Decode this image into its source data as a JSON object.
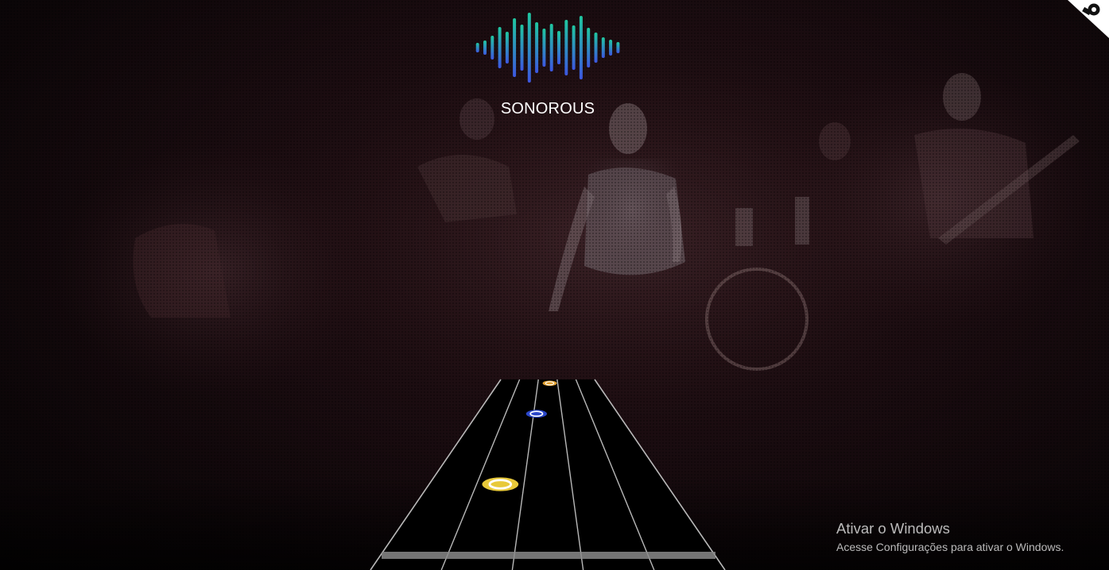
{
  "app": {
    "logo_text": "SONOROUS"
  },
  "highway": {
    "strings": 5,
    "notes": [
      {
        "color": "#e8c93a",
        "lane": 2,
        "progress": 0.55
      },
      {
        "color": "#2a46c8",
        "lane": 2.6,
        "progress": 0.18
      },
      {
        "color": "#e0a030",
        "lane": 3.1,
        "progress": 0.02
      }
    ],
    "note_ring_color": "#ffffff"
  },
  "logo": {
    "gradient_top": "#1fc7a0",
    "gradient_bottom": "#3d56e0"
  },
  "watermark": {
    "title": "Ativar o Windows",
    "subtitle": "Acesse Configurações para ativar o Windows."
  },
  "colors": {
    "background": "#1a0c10",
    "highway": "#000000",
    "string": "#d8d8d8",
    "strike_bar": "#8a8a8a"
  }
}
